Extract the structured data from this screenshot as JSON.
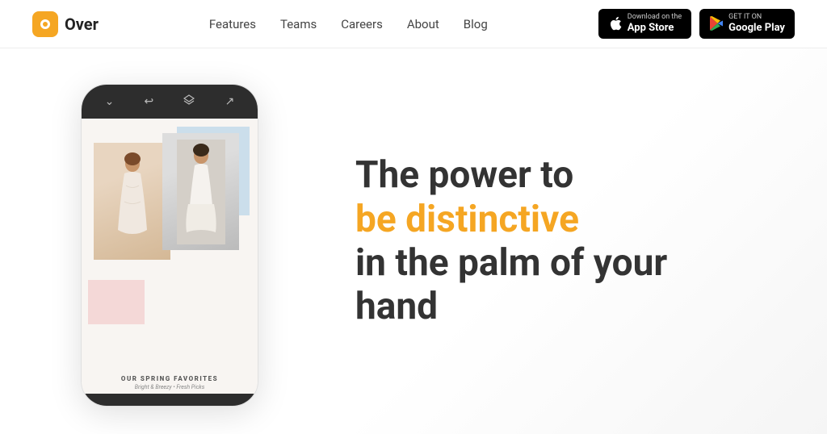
{
  "brand": {
    "logo_text": "Over",
    "logo_icon": "O"
  },
  "nav": {
    "items": [
      {
        "label": "Features",
        "id": "features"
      },
      {
        "label": "Teams",
        "id": "teams"
      },
      {
        "label": "Careers",
        "id": "careers"
      },
      {
        "label": "About",
        "id": "about"
      },
      {
        "label": "Blog",
        "id": "blog"
      }
    ]
  },
  "store_buttons": {
    "appstore": {
      "sub": "Download on the",
      "main": "App Store"
    },
    "googleplay": {
      "sub": "GET IT ON",
      "main": "Google Play"
    }
  },
  "phone": {
    "caption_title": "OUR SPRING FAVORITES",
    "caption_sub": "Bright & Breezy • Fresh Picks"
  },
  "hero": {
    "line1": "The power to",
    "line2": "be distinctive",
    "line3": "in the palm of your",
    "line4": "hand"
  },
  "colors": {
    "accent": "#f5a623",
    "dark": "#333",
    "phone_toolbar": "#2d2d2d"
  }
}
